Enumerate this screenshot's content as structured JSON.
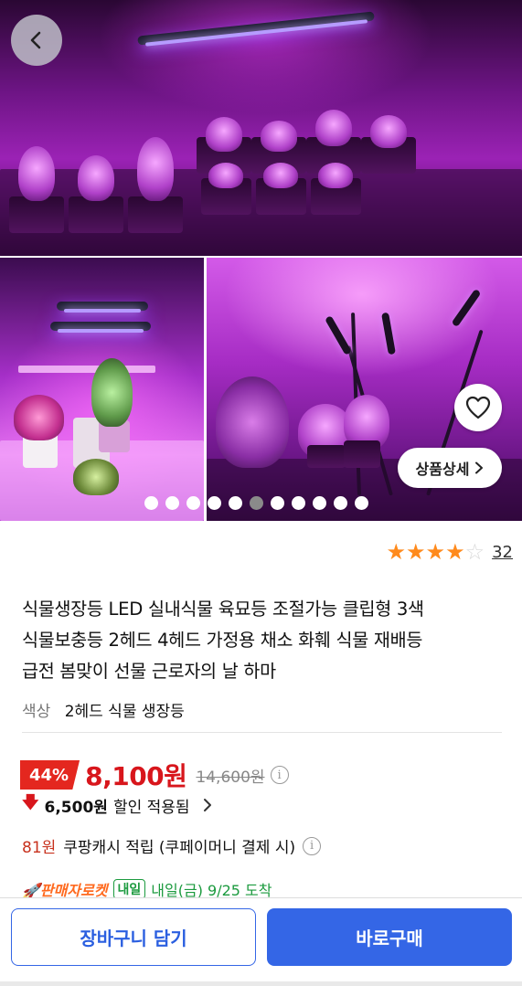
{
  "gallery": {
    "detail_label": "상품상세",
    "dots_total": 11,
    "dots_active_index": 5,
    "glow_color": "#c23be0"
  },
  "rating": {
    "stars": 4,
    "max_stars": 5,
    "review_count": "32",
    "star_color": "#ff8a1c"
  },
  "product": {
    "title_line1": "식물생장등 LED 실내식물 육묘등 조절가능 클립형 3색",
    "title_line2": "식물보충등 2헤드 4헤드 가정용 채소 화훼 식물 재배등",
    "title_line3": "급전 봄맞이 선물 근로자의 날 하마",
    "option_label": "색상",
    "option_value": "2헤드 식물 생장등"
  },
  "price": {
    "discount_badge": "44%",
    "sale_price": "8,100원",
    "original_price": "14,600원",
    "discount_amount": "6,500원",
    "discount_text": "할인 적용됨",
    "accent_color": "#d8161c"
  },
  "cashback": {
    "amount": "81원",
    "text": "쿠팡캐시 적립 (쿠페이머니 결제 시)"
  },
  "delivery": {
    "brand": "🚀판매자로켓",
    "badge": "내일",
    "eta": "내일(금) 9/25 도착"
  },
  "actions": {
    "cart_label": "장바구니 담기",
    "buy_label": "바로구매",
    "primary_color": "#3466e6"
  }
}
